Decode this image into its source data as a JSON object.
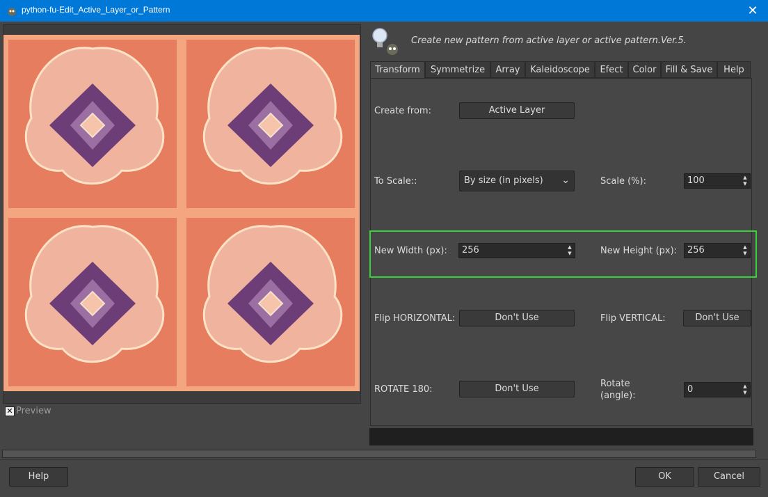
{
  "window": {
    "title": "python-fu-Edit_Active_Layer_or_Pattern",
    "close_icon": "close-icon"
  },
  "preview": {
    "label": "Preview",
    "checked": true
  },
  "header": {
    "text": "Create new pattern from active layer or active pattern.Ver.5."
  },
  "tabs": [
    {
      "label": "Transform",
      "active": true
    },
    {
      "label": "Symmetrize"
    },
    {
      "label": "Array"
    },
    {
      "label": "Kaleidoscope"
    },
    {
      "label": "Efect"
    },
    {
      "label": "Color"
    },
    {
      "label": "Fill & Save"
    },
    {
      "label": "Help"
    }
  ],
  "form": {
    "create_from": {
      "label": "Create from:",
      "value": "Active Layer"
    },
    "to_scale": {
      "label": "To Scale::",
      "value": "By size (in pixels)"
    },
    "scale_pct": {
      "label": "Scale (%):",
      "value": "100"
    },
    "new_width": {
      "label": "New Width (px):",
      "value": "256"
    },
    "new_height": {
      "label": "New Height (px):",
      "value": "256"
    },
    "flip_h": {
      "label": "Flip HORIZONTAL:",
      "value": "Don't Use"
    },
    "flip_v": {
      "label": "Flip VERTICAL:",
      "value": "Don't Use"
    },
    "rotate_180": {
      "label": "ROTATE 180:",
      "value": "Don't Use"
    },
    "rotate_angle": {
      "label_line1": "Rotate",
      "label_line2": "(angle):",
      "value": "0"
    }
  },
  "footer": {
    "help": "Help",
    "ok": "OK",
    "cancel": "Cancel"
  },
  "colors": {
    "titlebar": "#0078d7",
    "highlight": "#35d335",
    "pattern_bg": "#e57d5e"
  }
}
